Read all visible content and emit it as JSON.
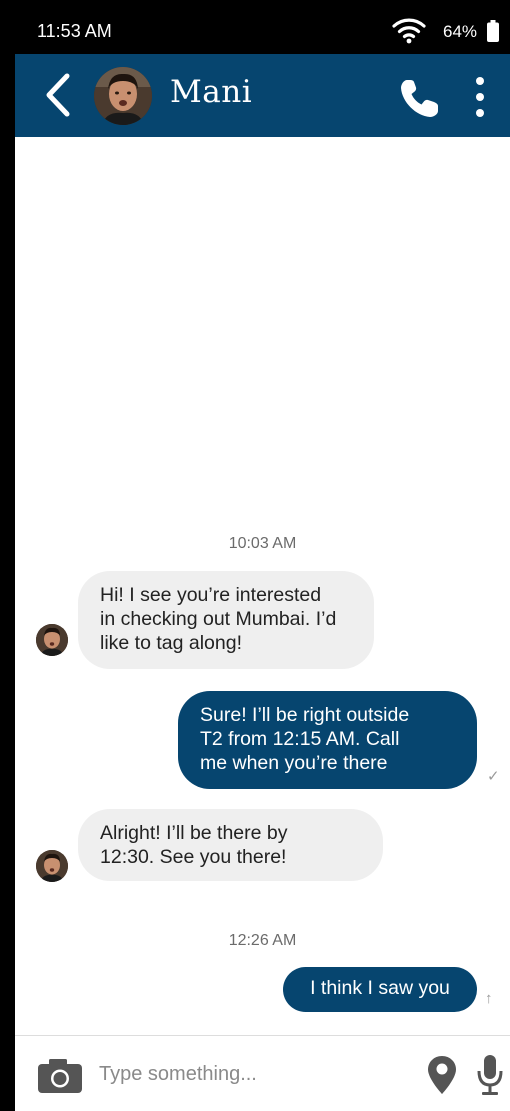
{
  "status_bar": {
    "time": "11:53 AM",
    "battery": "64%",
    "wifi_icon": "wifi-icon",
    "battery_icon": "battery-icon"
  },
  "header": {
    "back_icon": "chevron-left-icon",
    "contact_name": "Mani",
    "call_icon": "phone-icon",
    "more_icon": "more-vertical-icon"
  },
  "messages": [
    {
      "type": "timestamp",
      "text": "10:03 AM"
    },
    {
      "type": "incoming",
      "lines": [
        "Hi! I see you’re interested",
        "in checking out Mumbai. I’d",
        "like to tag along!"
      ]
    },
    {
      "type": "outgoing",
      "lines": [
        "Sure! I’ll be right outside",
        "T2 from 12:15 AM. Call",
        "me when you’re there"
      ],
      "status": "✓"
    },
    {
      "type": "incoming",
      "lines": [
        "Alright! I’ll be there by",
        "12:30. See you there!"
      ]
    },
    {
      "type": "timestamp",
      "text": "12:26 AM"
    },
    {
      "type": "outgoing",
      "lines": [
        "I think I saw you"
      ],
      "status": "↑"
    }
  ],
  "input_bar": {
    "camera_icon": "camera-icon",
    "placeholder": "Type something...",
    "value": "",
    "location_icon": "location-pin-icon",
    "mic_icon": "microphone-icon"
  },
  "colors": {
    "brand": "#06456f",
    "incoming_bubble": "#efefef",
    "background": "#ffffff"
  }
}
